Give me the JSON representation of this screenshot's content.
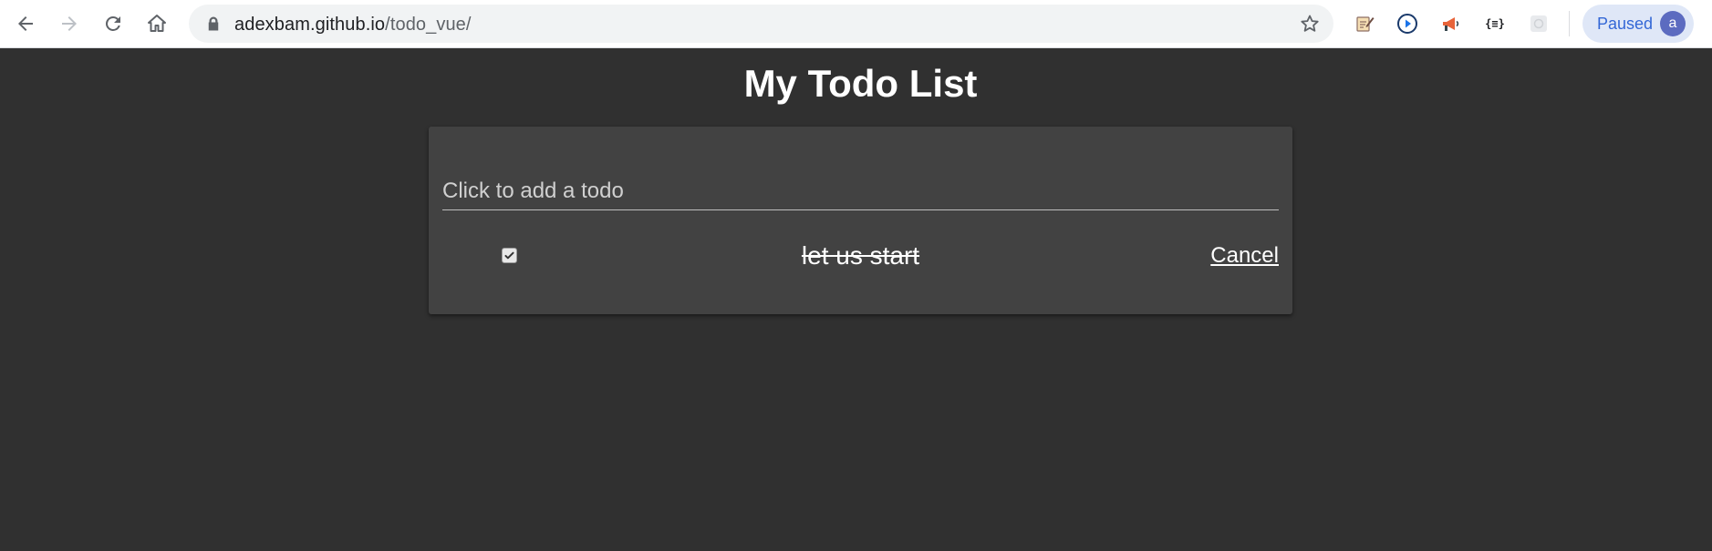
{
  "browser": {
    "url_domain": "adexbam.github.io",
    "url_path": "/todo_vue/",
    "profile_label": "Paused",
    "avatar_letter": "a",
    "icons": {
      "back": "arrow-left-icon",
      "forward": "arrow-right-icon",
      "reload": "reload-icon",
      "home": "home-icon",
      "lock": "lock-icon",
      "bookmark": "star-icon",
      "extensions": [
        "clipboard-pen-icon",
        "play-circle-icon",
        "megaphone-icon",
        "braces-icon",
        "grid-puzzle-icon"
      ]
    }
  },
  "app": {
    "title": "My Todo List",
    "input_placeholder": "Click to add a todo",
    "input_value": "",
    "todos": [
      {
        "text": "let us start",
        "done": true,
        "action_label": "Cancel"
      }
    ]
  },
  "colors": {
    "background": "#303030",
    "card": "#424242",
    "text": "#ffffff",
    "profile_accent": "#3367d6"
  }
}
